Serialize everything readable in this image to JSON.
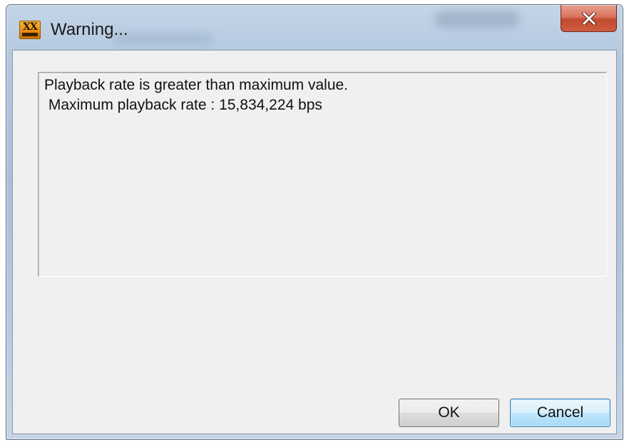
{
  "window": {
    "title": "Warning...",
    "app_icon": "xx-player-icon",
    "close_icon": "close-icon"
  },
  "message": {
    "lines": [
      "Playback rate is greater than maximum value.",
      " Maximum playback rate : 15,834,224 bps"
    ]
  },
  "buttons": {
    "ok_label": "OK",
    "cancel_label": "Cancel"
  },
  "colors": {
    "close_button": "#c9503a",
    "client_background": "#f0f0f0",
    "default_button_border": "#3c7fb1"
  }
}
